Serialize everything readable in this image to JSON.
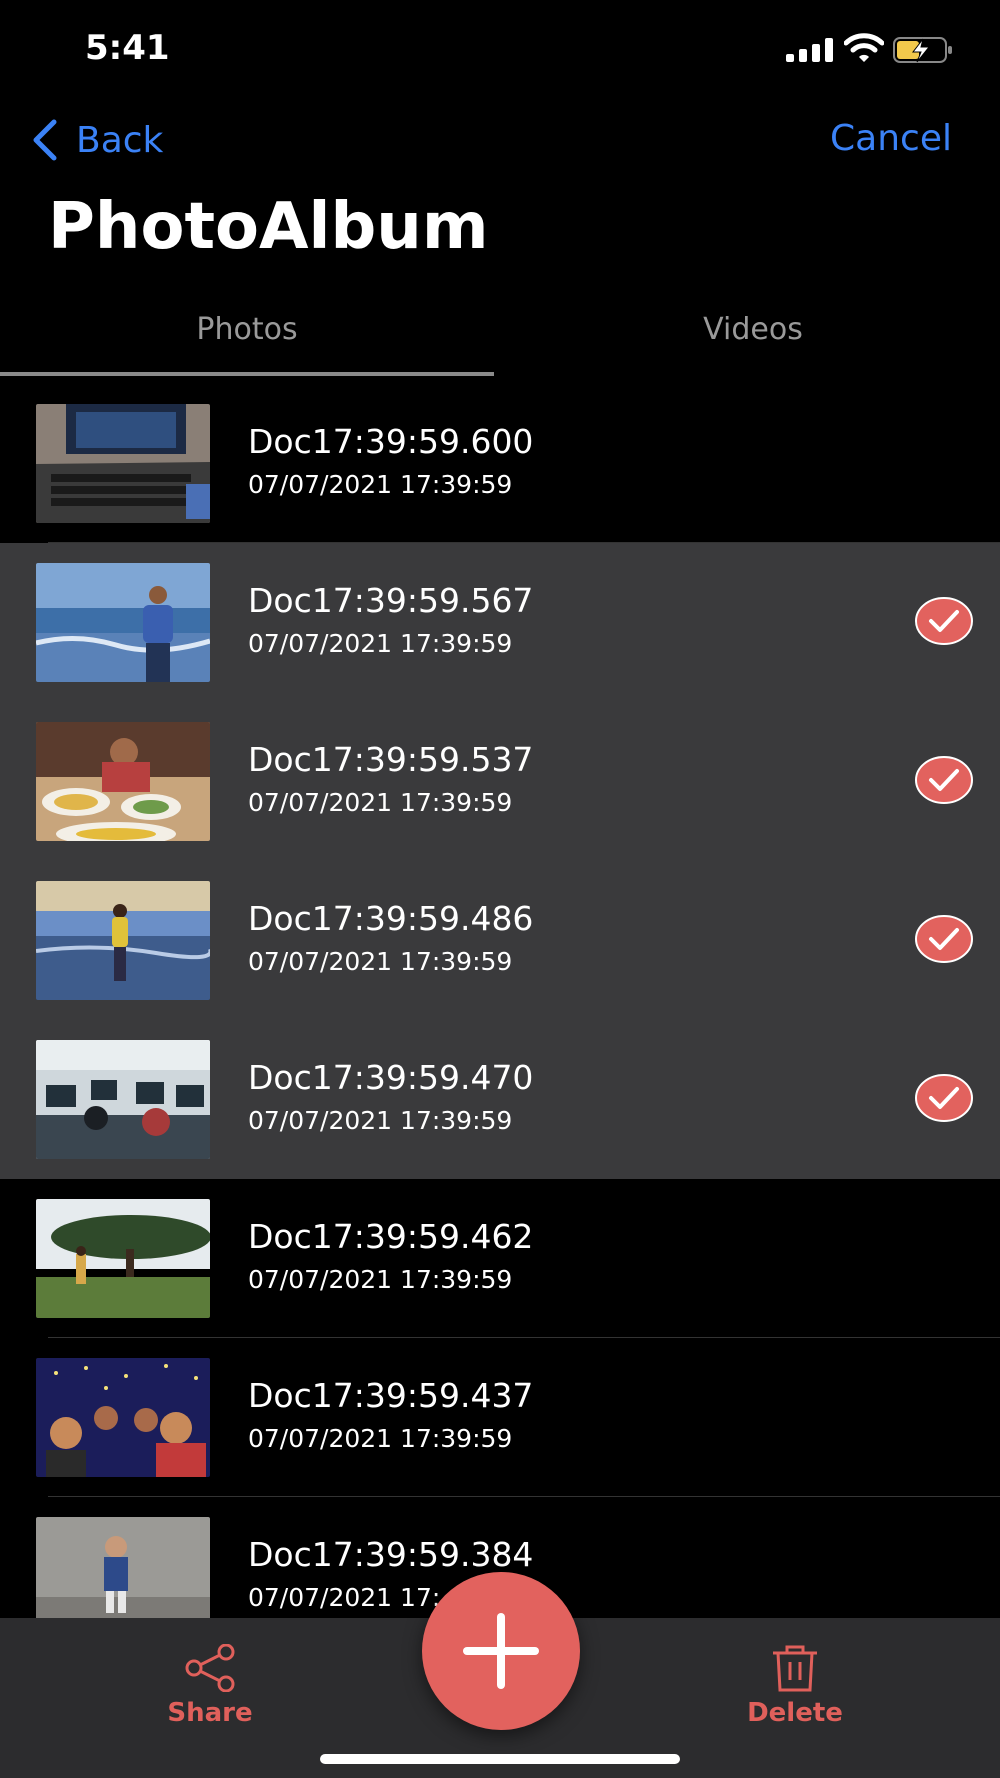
{
  "status": {
    "time": "5:41"
  },
  "nav": {
    "back_label": "Back",
    "cancel_label": "Cancel"
  },
  "title": "PhotoAlbum",
  "tabs": [
    {
      "label": "Photos",
      "active": true
    },
    {
      "label": "Videos",
      "active": false
    }
  ],
  "items": [
    {
      "name": "Doc17:39:59.600",
      "date": "07/07/2021 17:39:59",
      "selected": false,
      "thumb": "laptop"
    },
    {
      "name": "Doc17:39:59.567",
      "date": "07/07/2021 17:39:59",
      "selected": true,
      "thumb": "beach-man"
    },
    {
      "name": "Doc17:39:59.537",
      "date": "07/07/2021 17:39:59",
      "selected": true,
      "thumb": "dinner"
    },
    {
      "name": "Doc17:39:59.486",
      "date": "07/07/2021 17:39:59",
      "selected": true,
      "thumb": "beach-woman"
    },
    {
      "name": "Doc17:39:59.470",
      "date": "07/07/2021 17:39:59",
      "selected": true,
      "thumb": "office"
    },
    {
      "name": "Doc17:39:59.462",
      "date": "07/07/2021 17:39:59",
      "selected": false,
      "thumb": "tree-field"
    },
    {
      "name": "Doc17:39:59.437",
      "date": "07/07/2021 17:39:59",
      "selected": false,
      "thumb": "party"
    },
    {
      "name": "Doc17:39:59.384",
      "date": "07/07/2021 17:",
      "selected": false,
      "thumb": "child"
    }
  ],
  "toolbar": {
    "share_label": "Share",
    "delete_label": "Delete"
  },
  "colors": {
    "accent_blue": "#3b82f6",
    "accent_red": "#e2625e",
    "selected_bg": "#3a3a3c"
  },
  "icons": {
    "back": "chevron-left-icon",
    "check": "checkmark-circle-icon",
    "share": "share-icon",
    "delete": "trash-icon",
    "fab": "plus-icon"
  }
}
